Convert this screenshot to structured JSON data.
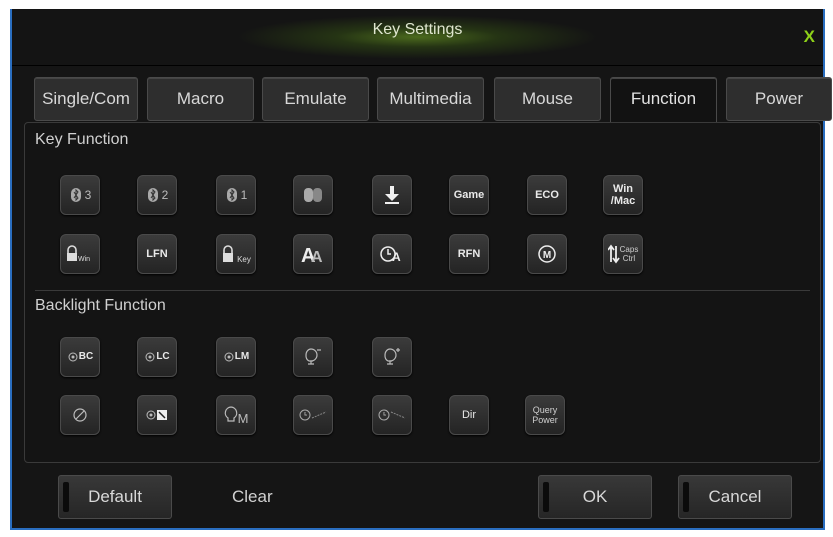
{
  "dialog": {
    "title": "Key Settings",
    "close_label": "X"
  },
  "tabs": [
    {
      "label": "Single/Com"
    },
    {
      "label": "Macro"
    },
    {
      "label": "Emulate"
    },
    {
      "label": "Multimedia"
    },
    {
      "label": "Mouse"
    },
    {
      "label": "Function"
    },
    {
      "label": "Power"
    }
  ],
  "active_tab": "Function",
  "key_function": {
    "heading": "Key Function",
    "row1": [
      {
        "icon": "bluetooth-3-icon",
        "text": "3"
      },
      {
        "icon": "bluetooth-2-icon",
        "text": "2"
      },
      {
        "icon": "bluetooth-1-icon",
        "text": "1"
      },
      {
        "icon": "bluetooth-pair-icon",
        "text": ""
      },
      {
        "icon": "arrow-down-icon",
        "text": ""
      },
      {
        "icon": "game-icon",
        "text": "Game"
      },
      {
        "icon": "eco-icon",
        "text": "ECO"
      },
      {
        "icon": "win-mac-icon",
        "text": "Win\n/Mac"
      }
    ],
    "row2": [
      {
        "icon": "lock-win-icon",
        "text": ""
      },
      {
        "icon": "lfn-icon",
        "text": "LFN"
      },
      {
        "icon": "lock-key-icon",
        "text": "Key"
      },
      {
        "icon": "font-size-icon",
        "text": ""
      },
      {
        "icon": "clock-a-icon",
        "text": ""
      },
      {
        "icon": "rfn-icon",
        "text": "RFN"
      },
      {
        "icon": "m-circle-icon",
        "text": "M"
      },
      {
        "icon": "caps-ctrl-swap-icon",
        "text": "Caps\nCtrl"
      }
    ]
  },
  "backlight_function": {
    "heading": "Backlight Function",
    "row1": [
      {
        "icon": "backlight-bc-icon",
        "text": "BC"
      },
      {
        "icon": "backlight-lc-icon",
        "text": "LC"
      },
      {
        "icon": "backlight-lm-icon",
        "text": "LM"
      },
      {
        "icon": "bulb-minus-icon",
        "text": ""
      },
      {
        "icon": "bulb-plus-icon",
        "text": ""
      }
    ],
    "row2": [
      {
        "icon": "backlight-off-icon",
        "text": ""
      },
      {
        "icon": "backlight-custom-icon",
        "text": ""
      },
      {
        "icon": "bulb-m-icon",
        "text": "M"
      },
      {
        "icon": "speed-up-icon",
        "text": ""
      },
      {
        "icon": "speed-down-icon",
        "text": ""
      },
      {
        "icon": "dir-icon",
        "text": "Dir"
      },
      {
        "icon": "query-power-icon",
        "text": "Query\nPower"
      }
    ]
  },
  "footer": {
    "default_label": "Default",
    "clear_label": "Clear",
    "ok_label": "OK",
    "cancel_label": "Cancel"
  },
  "colors": {
    "accent": "#8ed119",
    "border": "#2a6ec0",
    "background": "#151515"
  }
}
